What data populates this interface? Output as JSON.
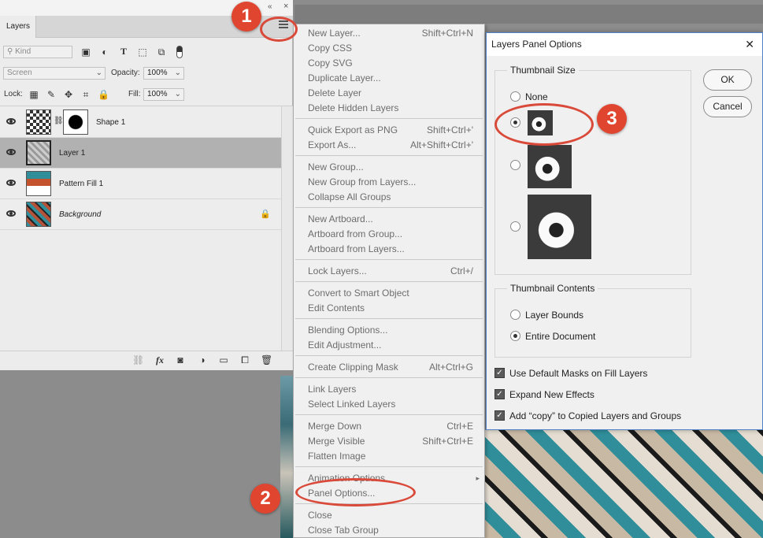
{
  "layers_panel": {
    "tab_label": "Layers",
    "kind_placeholder": "Kind",
    "blend_mode": "Screen",
    "opacity_label": "Opacity:",
    "opacity_value": "100%",
    "lock_label": "Lock:",
    "fill_label": "Fill:",
    "fill_value": "100%",
    "layers": [
      {
        "name": "Shape 1"
      },
      {
        "name": "Layer 1"
      },
      {
        "name": "Pattern Fill 1"
      },
      {
        "name": "Background"
      }
    ],
    "bottom_icons": [
      "link-icon",
      "fx-icon",
      "mask-icon",
      "adjustment-icon",
      "folder-icon",
      "new-layer-icon",
      "trash-icon"
    ]
  },
  "menu": {
    "items": [
      {
        "label": "New Layer...",
        "shortcut": "Shift+Ctrl+N"
      },
      {
        "label": "Copy CSS",
        "shortcut": ""
      },
      {
        "label": "Copy SVG",
        "shortcut": ""
      },
      {
        "label": "Duplicate Layer...",
        "shortcut": ""
      },
      {
        "label": "Delete Layer",
        "shortcut": ""
      },
      {
        "label": "Delete Hidden Layers",
        "shortcut": ""
      },
      {
        "label": "Quick Export as PNG",
        "shortcut": "Shift+Ctrl+'"
      },
      {
        "label": "Export As...",
        "shortcut": "Alt+Shift+Ctrl+'"
      },
      {
        "label": "New Group...",
        "shortcut": ""
      },
      {
        "label": "New Group from Layers...",
        "shortcut": ""
      },
      {
        "label": "Collapse All Groups",
        "shortcut": ""
      },
      {
        "label": "New Artboard...",
        "shortcut": ""
      },
      {
        "label": "Artboard from Group...",
        "shortcut": ""
      },
      {
        "label": "Artboard from Layers...",
        "shortcut": ""
      },
      {
        "label": "Lock Layers...",
        "shortcut": "Ctrl+/"
      },
      {
        "label": "Convert to Smart Object",
        "shortcut": ""
      },
      {
        "label": "Edit Contents",
        "shortcut": ""
      },
      {
        "label": "Blending Options...",
        "shortcut": ""
      },
      {
        "label": "Edit Adjustment...",
        "shortcut": ""
      },
      {
        "label": "Create Clipping Mask",
        "shortcut": "Alt+Ctrl+G"
      },
      {
        "label": "Link Layers",
        "shortcut": ""
      },
      {
        "label": "Select Linked Layers",
        "shortcut": ""
      },
      {
        "label": "Merge Down",
        "shortcut": "Ctrl+E"
      },
      {
        "label": "Merge Visible",
        "shortcut": "Shift+Ctrl+E"
      },
      {
        "label": "Flatten Image",
        "shortcut": ""
      },
      {
        "label": "Animation Options",
        "shortcut": ""
      },
      {
        "label": "Panel Options...",
        "shortcut": ""
      },
      {
        "label": "Close",
        "shortcut": ""
      },
      {
        "label": "Close Tab Group",
        "shortcut": ""
      }
    ]
  },
  "dialog": {
    "title": "Layers Panel Options",
    "close_glyph": "✕",
    "thumb_size_title": "Thumbnail Size",
    "none_label": "None",
    "thumb_contents_title": "Thumbnail Contents",
    "layer_bounds_label": "Layer Bounds",
    "entire_document_label": "Entire Document",
    "check1": "Use Default Masks on Fill Layers",
    "check2": "Expand New Effects",
    "check3": "Add “copy” to Copied Layers and Groups",
    "ok_label": "OK",
    "cancel_label": "Cancel"
  },
  "annotations": {
    "b1": "1",
    "b2": "2",
    "b3": "3"
  },
  "colors": {
    "annotation": "#e0452f",
    "selected_layer": "#b1b1b1"
  }
}
